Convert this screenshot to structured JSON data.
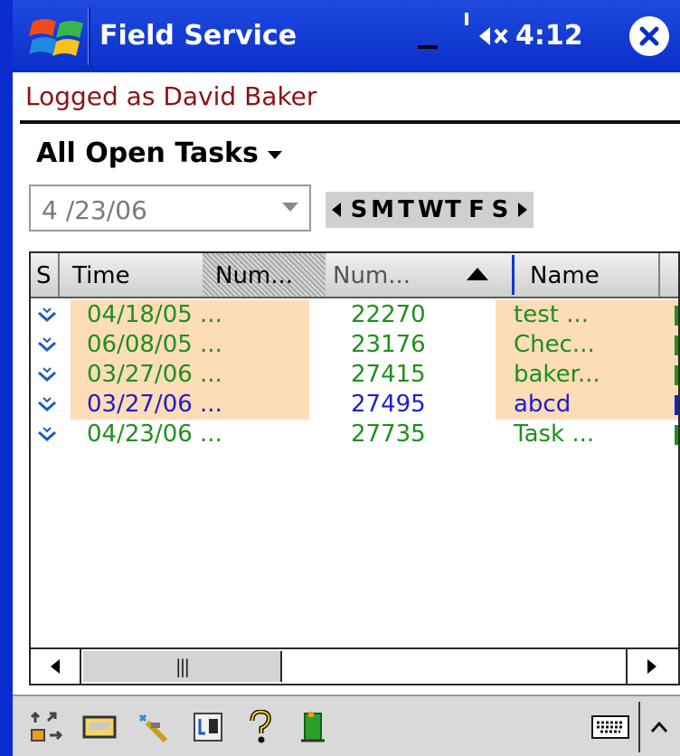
{
  "titlebar": {
    "app_title": "Field Service",
    "time": "4:12"
  },
  "logged_text": "Logged as David Baker",
  "view": {
    "label": "All Open Tasks"
  },
  "date": {
    "value": "4 /23/06"
  },
  "week": {
    "days": [
      "S",
      "M",
      "T",
      "W",
      "T",
      "F",
      "S"
    ]
  },
  "grid": {
    "headers": [
      "S",
      "Time",
      "Num...",
      "Num...",
      "Name"
    ],
    "rows": [
      {
        "time": "04/18/05 ...",
        "number": "22270",
        "name": "test ...",
        "text_color": "#1f8f1f",
        "highlight": true
      },
      {
        "time": "06/08/05 ...",
        "number": "23176",
        "name": "Chec...",
        "text_color": "#1f8f1f",
        "highlight": true
      },
      {
        "time": "03/27/06 ...",
        "number": "27415",
        "name": "baker...",
        "text_color": "#1f8f1f",
        "highlight": true
      },
      {
        "time": "03/27/06 ...",
        "number": "27495",
        "name": "abcd",
        "text_color": "#1e1ec8",
        "highlight": true
      },
      {
        "time": "04/23/06 ...",
        "number": "27735",
        "name": "Task ...",
        "text_color": "#1f8f1f",
        "highlight": false
      }
    ]
  },
  "colors": {
    "titlebar": "#0a2fc8",
    "logged_text": "#8a1414",
    "highlight": "#fddcb8"
  },
  "toolbar": {
    "icons": [
      "sync-icon",
      "message-icon",
      "tools-icon",
      "sort-icon",
      "help-icon",
      "exit-icon",
      "keyboard-icon"
    ]
  }
}
